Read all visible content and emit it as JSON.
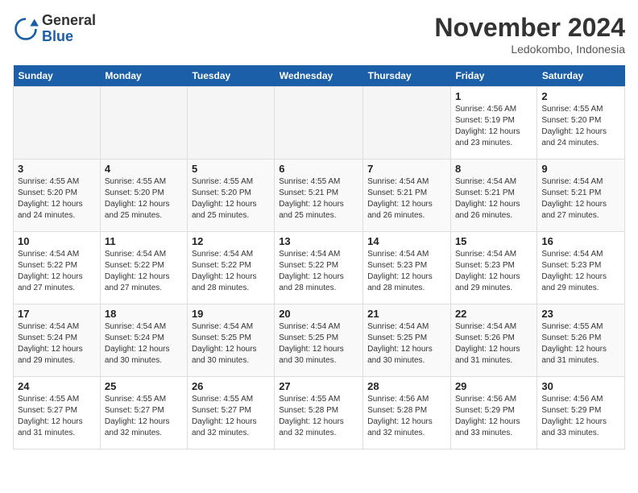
{
  "header": {
    "logo_general": "General",
    "logo_blue": "Blue",
    "month_title": "November 2024",
    "location": "Ledokombo, Indonesia"
  },
  "days_of_week": [
    "Sunday",
    "Monday",
    "Tuesday",
    "Wednesday",
    "Thursday",
    "Friday",
    "Saturday"
  ],
  "weeks": [
    [
      {
        "day": "",
        "empty": true
      },
      {
        "day": "",
        "empty": true
      },
      {
        "day": "",
        "empty": true
      },
      {
        "day": "",
        "empty": true
      },
      {
        "day": "",
        "empty": true
      },
      {
        "day": "1",
        "sunrise": "Sunrise: 4:56 AM",
        "sunset": "Sunset: 5:19 PM",
        "daylight": "Daylight: 12 hours and 23 minutes."
      },
      {
        "day": "2",
        "sunrise": "Sunrise: 4:55 AM",
        "sunset": "Sunset: 5:20 PM",
        "daylight": "Daylight: 12 hours and 24 minutes."
      }
    ],
    [
      {
        "day": "3",
        "sunrise": "Sunrise: 4:55 AM",
        "sunset": "Sunset: 5:20 PM",
        "daylight": "Daylight: 12 hours and 24 minutes."
      },
      {
        "day": "4",
        "sunrise": "Sunrise: 4:55 AM",
        "sunset": "Sunset: 5:20 PM",
        "daylight": "Daylight: 12 hours and 25 minutes."
      },
      {
        "day": "5",
        "sunrise": "Sunrise: 4:55 AM",
        "sunset": "Sunset: 5:20 PM",
        "daylight": "Daylight: 12 hours and 25 minutes."
      },
      {
        "day": "6",
        "sunrise": "Sunrise: 4:55 AM",
        "sunset": "Sunset: 5:21 PM",
        "daylight": "Daylight: 12 hours and 25 minutes."
      },
      {
        "day": "7",
        "sunrise": "Sunrise: 4:54 AM",
        "sunset": "Sunset: 5:21 PM",
        "daylight": "Daylight: 12 hours and 26 minutes."
      },
      {
        "day": "8",
        "sunrise": "Sunrise: 4:54 AM",
        "sunset": "Sunset: 5:21 PM",
        "daylight": "Daylight: 12 hours and 26 minutes."
      },
      {
        "day": "9",
        "sunrise": "Sunrise: 4:54 AM",
        "sunset": "Sunset: 5:21 PM",
        "daylight": "Daylight: 12 hours and 27 minutes."
      }
    ],
    [
      {
        "day": "10",
        "sunrise": "Sunrise: 4:54 AM",
        "sunset": "Sunset: 5:22 PM",
        "daylight": "Daylight: 12 hours and 27 minutes."
      },
      {
        "day": "11",
        "sunrise": "Sunrise: 4:54 AM",
        "sunset": "Sunset: 5:22 PM",
        "daylight": "Daylight: 12 hours and 27 minutes."
      },
      {
        "day": "12",
        "sunrise": "Sunrise: 4:54 AM",
        "sunset": "Sunset: 5:22 PM",
        "daylight": "Daylight: 12 hours and 28 minutes."
      },
      {
        "day": "13",
        "sunrise": "Sunrise: 4:54 AM",
        "sunset": "Sunset: 5:22 PM",
        "daylight": "Daylight: 12 hours and 28 minutes."
      },
      {
        "day": "14",
        "sunrise": "Sunrise: 4:54 AM",
        "sunset": "Sunset: 5:23 PM",
        "daylight": "Daylight: 12 hours and 28 minutes."
      },
      {
        "day": "15",
        "sunrise": "Sunrise: 4:54 AM",
        "sunset": "Sunset: 5:23 PM",
        "daylight": "Daylight: 12 hours and 29 minutes."
      },
      {
        "day": "16",
        "sunrise": "Sunrise: 4:54 AM",
        "sunset": "Sunset: 5:23 PM",
        "daylight": "Daylight: 12 hours and 29 minutes."
      }
    ],
    [
      {
        "day": "17",
        "sunrise": "Sunrise: 4:54 AM",
        "sunset": "Sunset: 5:24 PM",
        "daylight": "Daylight: 12 hours and 29 minutes."
      },
      {
        "day": "18",
        "sunrise": "Sunrise: 4:54 AM",
        "sunset": "Sunset: 5:24 PM",
        "daylight": "Daylight: 12 hours and 30 minutes."
      },
      {
        "day": "19",
        "sunrise": "Sunrise: 4:54 AM",
        "sunset": "Sunset: 5:25 PM",
        "daylight": "Daylight: 12 hours and 30 minutes."
      },
      {
        "day": "20",
        "sunrise": "Sunrise: 4:54 AM",
        "sunset": "Sunset: 5:25 PM",
        "daylight": "Daylight: 12 hours and 30 minutes."
      },
      {
        "day": "21",
        "sunrise": "Sunrise: 4:54 AM",
        "sunset": "Sunset: 5:25 PM",
        "daylight": "Daylight: 12 hours and 30 minutes."
      },
      {
        "day": "22",
        "sunrise": "Sunrise: 4:54 AM",
        "sunset": "Sunset: 5:26 PM",
        "daylight": "Daylight: 12 hours and 31 minutes."
      },
      {
        "day": "23",
        "sunrise": "Sunrise: 4:55 AM",
        "sunset": "Sunset: 5:26 PM",
        "daylight": "Daylight: 12 hours and 31 minutes."
      }
    ],
    [
      {
        "day": "24",
        "sunrise": "Sunrise: 4:55 AM",
        "sunset": "Sunset: 5:27 PM",
        "daylight": "Daylight: 12 hours and 31 minutes."
      },
      {
        "day": "25",
        "sunrise": "Sunrise: 4:55 AM",
        "sunset": "Sunset: 5:27 PM",
        "daylight": "Daylight: 12 hours and 32 minutes."
      },
      {
        "day": "26",
        "sunrise": "Sunrise: 4:55 AM",
        "sunset": "Sunset: 5:27 PM",
        "daylight": "Daylight: 12 hours and 32 minutes."
      },
      {
        "day": "27",
        "sunrise": "Sunrise: 4:55 AM",
        "sunset": "Sunset: 5:28 PM",
        "daylight": "Daylight: 12 hours and 32 minutes."
      },
      {
        "day": "28",
        "sunrise": "Sunrise: 4:56 AM",
        "sunset": "Sunset: 5:28 PM",
        "daylight": "Daylight: 12 hours and 32 minutes."
      },
      {
        "day": "29",
        "sunrise": "Sunrise: 4:56 AM",
        "sunset": "Sunset: 5:29 PM",
        "daylight": "Daylight: 12 hours and 33 minutes."
      },
      {
        "day": "30",
        "sunrise": "Sunrise: 4:56 AM",
        "sunset": "Sunset: 5:29 PM",
        "daylight": "Daylight: 12 hours and 33 minutes."
      }
    ]
  ]
}
